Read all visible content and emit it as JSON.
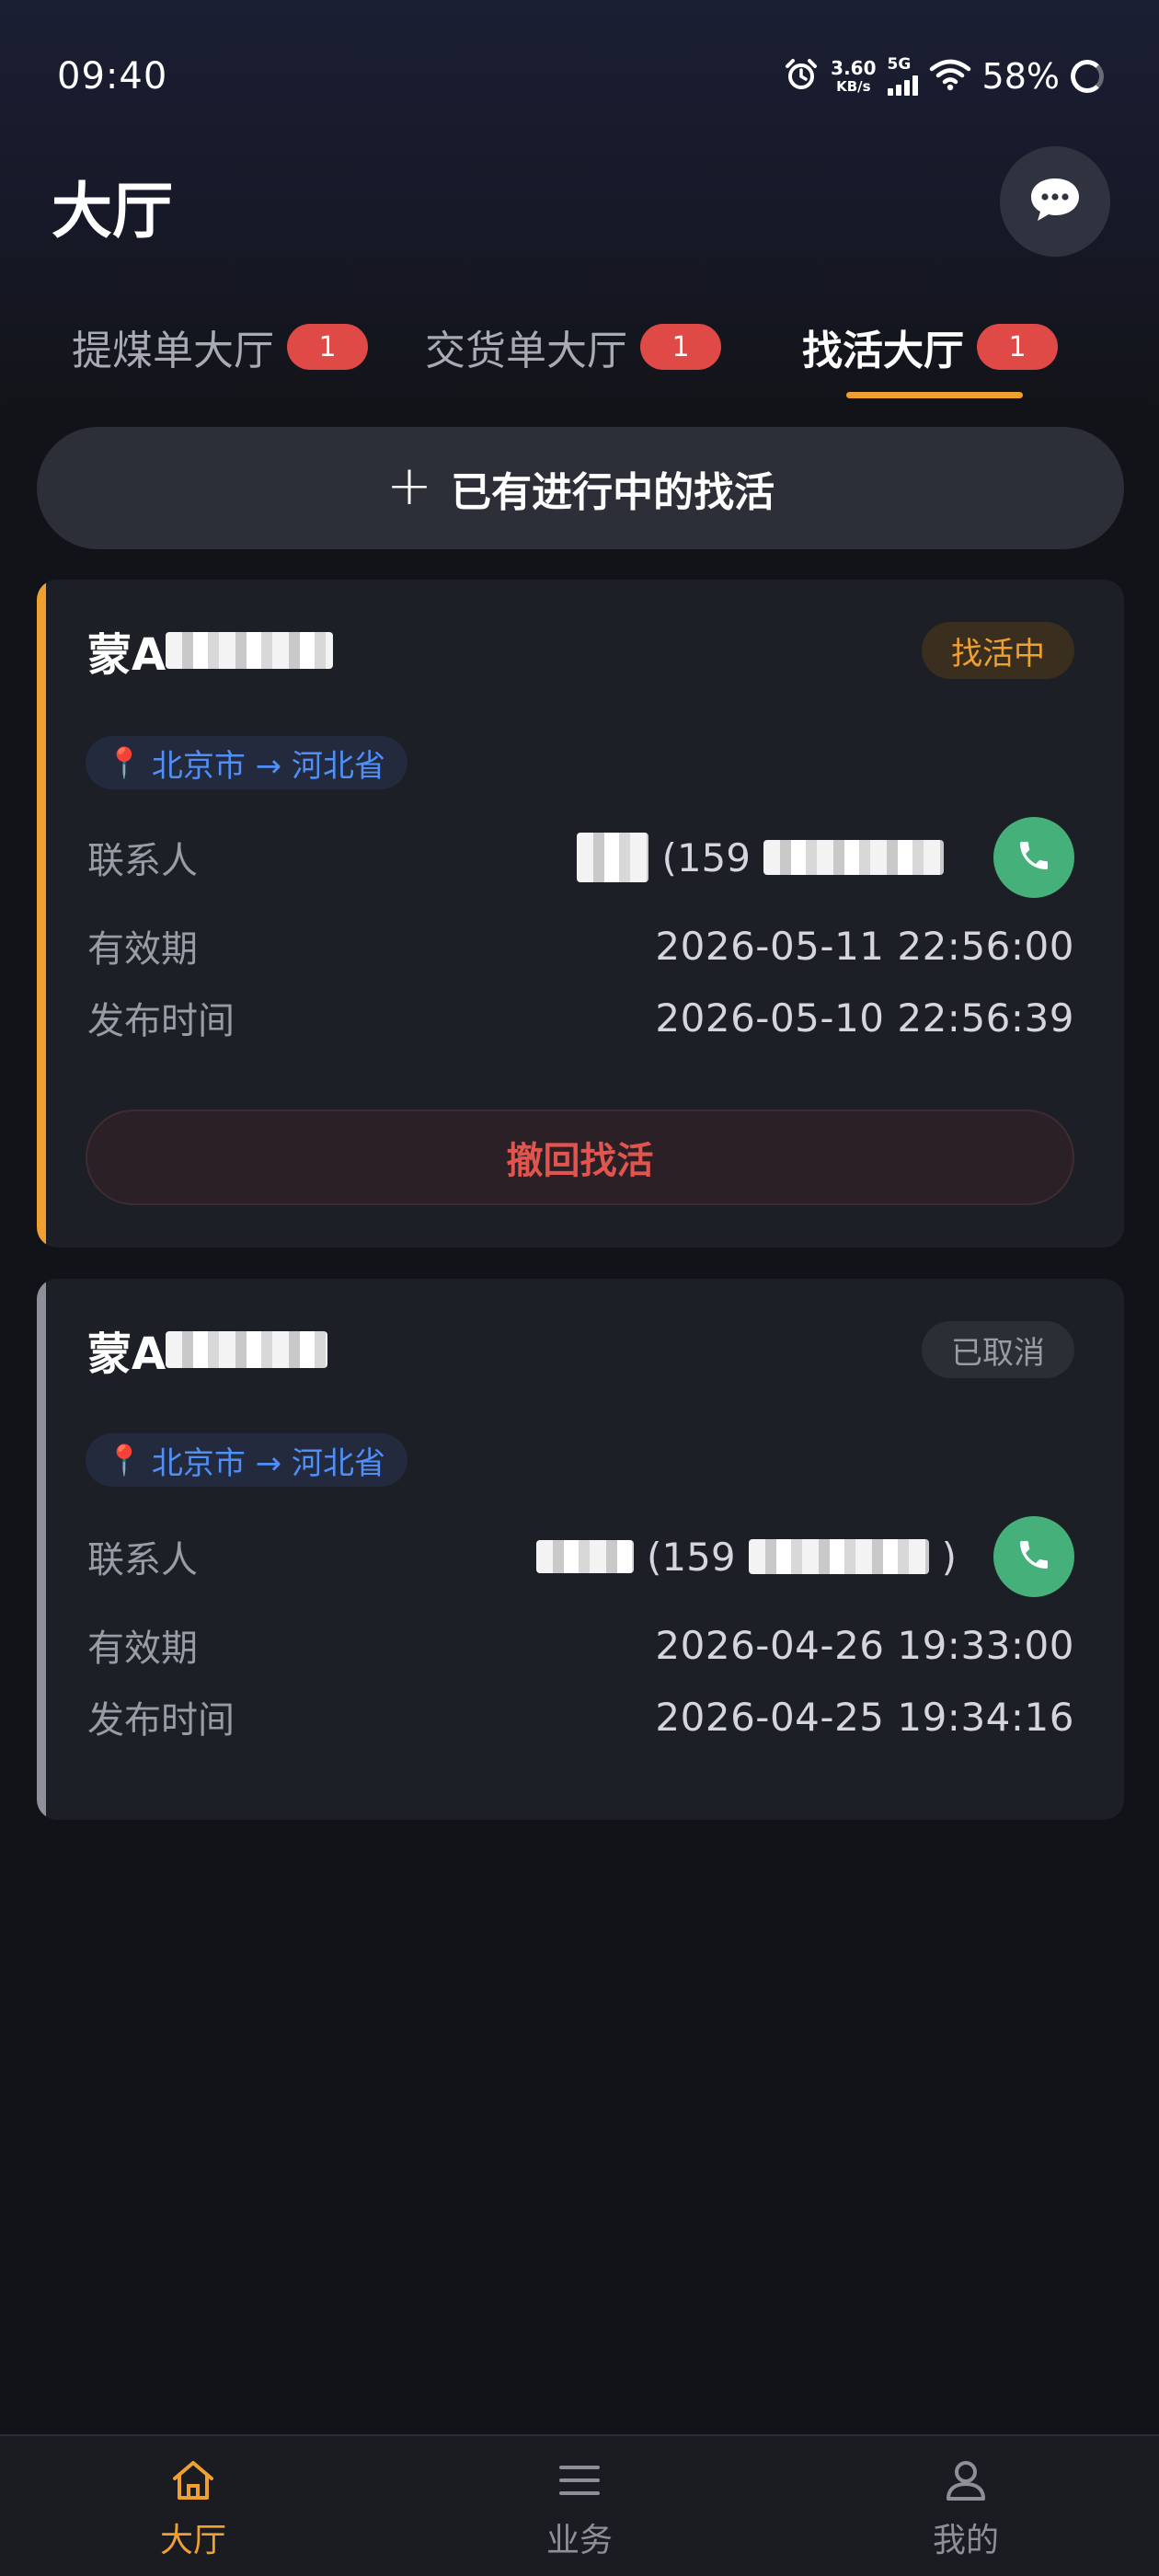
{
  "status_bar": {
    "time": "09:40",
    "net_speed_value": "3.60",
    "net_speed_unit": "KB/s",
    "network": "5G",
    "battery": "58%"
  },
  "header": {
    "title": "大厅",
    "message_icon": "chat-bubble-icon"
  },
  "tabs": [
    {
      "label": "提煤单大厅",
      "badge": "1",
      "active": false
    },
    {
      "label": "交货单大厅",
      "badge": "1",
      "active": false
    },
    {
      "label": "找活大厅",
      "badge": "1",
      "active": true
    }
  ],
  "new_button": {
    "plus": "+",
    "label": "已有进行中的找活"
  },
  "cards": [
    {
      "plate_prefix": "蒙A",
      "status": "找活中",
      "route": "北京市 → 河北省",
      "contact_label": "联系人",
      "contact_phone_prefix": "(159",
      "contact_phone_suffix": "",
      "validity_label": "有效期",
      "validity": "2026-05-11 22:56:00",
      "publish_label": "发布时间",
      "publish_time": "2026-05-10 22:56:39",
      "action": "撤回找活",
      "accent_color": "#f0a030"
    },
    {
      "plate_prefix": "蒙A",
      "status": "已取消",
      "route": "北京市 → 河北省",
      "contact_label": "联系人",
      "contact_phone_prefix": "(159",
      "contact_phone_suffix": ")",
      "validity_label": "有效期",
      "validity": "2026-04-26 19:33:00",
      "publish_label": "发布时间",
      "publish_time": "2026-04-25 19:34:16",
      "accent_color": "#8e9099"
    }
  ],
  "bottom_nav": [
    {
      "label": "大厅",
      "icon": "home-icon",
      "active": true
    },
    {
      "label": "业务",
      "icon": "menu-icon",
      "active": false
    },
    {
      "label": "我的",
      "icon": "user-icon",
      "active": false
    }
  ],
  "colors": {
    "accent": "#f0a030",
    "badge": "#e04a46",
    "call": "#45b07a",
    "route_text": "#4f8ff7"
  }
}
